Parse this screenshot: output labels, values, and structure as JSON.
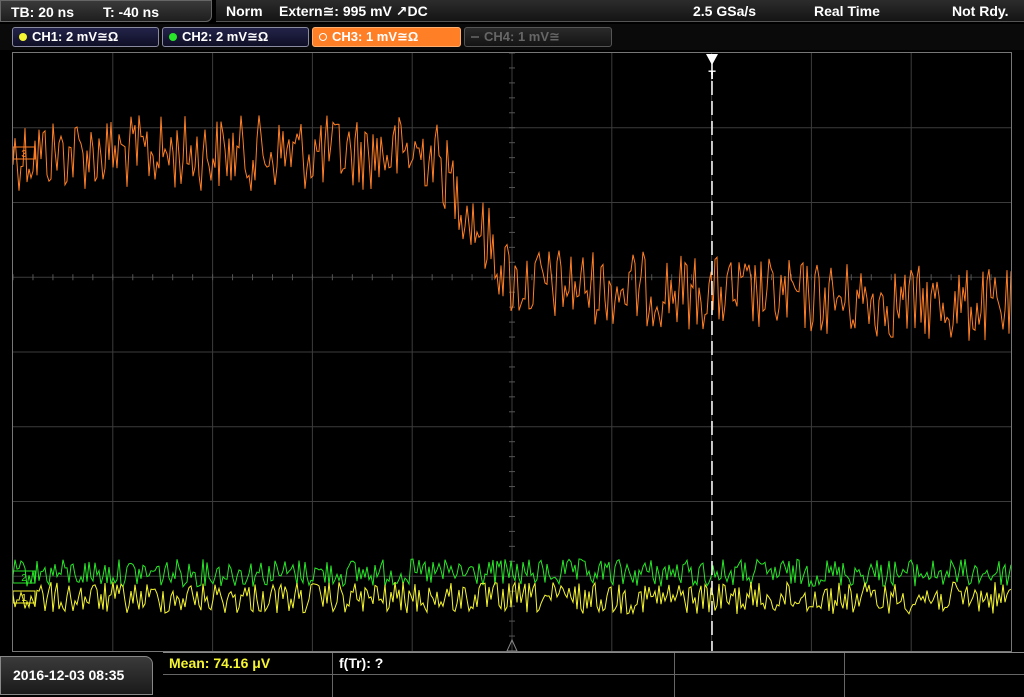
{
  "topbar": {
    "timebase": "TB: 20 ns",
    "trigger_time": "T: -40 ns",
    "trigger_mode": "Norm",
    "trigger_source": "Extern≅: 995 mV ↗DC",
    "sample_rate": "2.5 GSa/s",
    "acq_mode": "Real Time",
    "status": "Not Rdy."
  },
  "channels": [
    {
      "label": "CH1: 2 mV≅Ω",
      "color": "#f5f532",
      "state": "on"
    },
    {
      "label": "CH2: 2 mV≅Ω",
      "color": "#28e628",
      "state": "on"
    },
    {
      "label": "CH3: 1 mV≅Ω",
      "color": "#ff7f27",
      "state": "selected"
    },
    {
      "label": "CH4: 1 mV≅",
      "color": "#666666",
      "state": "off"
    }
  ],
  "screen": {
    "trigger_marker": "T",
    "channel_markers": [
      "1",
      "2",
      "3"
    ]
  },
  "footer": {
    "datetime": "2016-12-03 08:35",
    "measurement_mean": "Mean: 74.16 μV",
    "measurement_freq": "f(Tr): ?"
  },
  "colors": {
    "ch1": "#f5f532",
    "ch2": "#28e628",
    "ch3": "#ff7f27",
    "grid": "#3c3c3c"
  }
}
